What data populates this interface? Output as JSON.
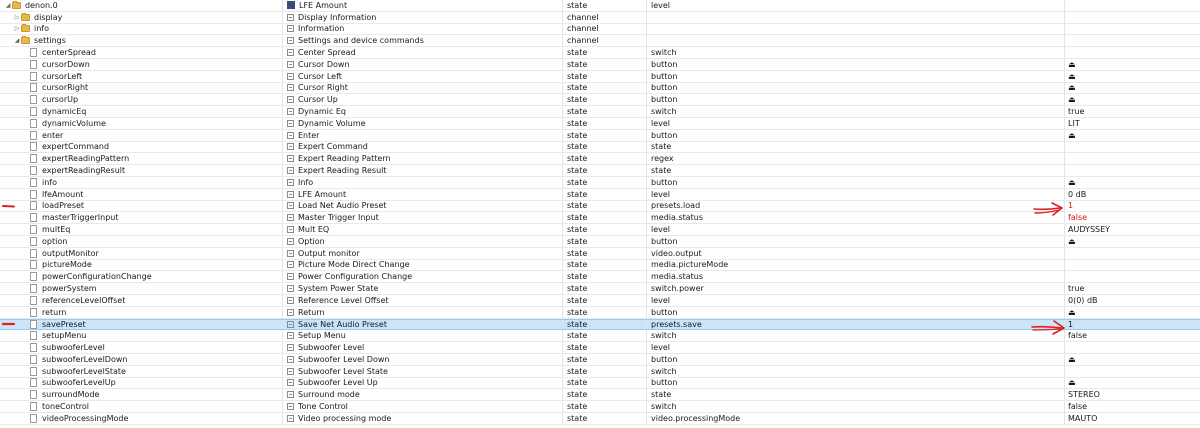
{
  "rows": [
    {
      "indent": 0,
      "expander": "◢",
      "icon": "folder",
      "id": "denon.0",
      "name": "LFE Amount",
      "name_icon": "device",
      "type": "state",
      "role": "level",
      "value": ""
    },
    {
      "indent": 1,
      "expander": "▷",
      "icon": "folder",
      "id": "display",
      "name": "Display Information",
      "name_icon": "doc",
      "type": "channel",
      "role": "",
      "value": ""
    },
    {
      "indent": 1,
      "expander": "▷",
      "icon": "folder",
      "id": "info",
      "name": "Information",
      "name_icon": "doc",
      "type": "channel",
      "role": "",
      "value": ""
    },
    {
      "indent": 1,
      "expander": "◢",
      "icon": "folder",
      "id": "settings",
      "name": "Settings and device commands",
      "name_icon": "doc",
      "type": "channel",
      "role": "",
      "value": ""
    },
    {
      "indent": 2,
      "icon": "file",
      "id": "centerSpread",
      "name": "Center Spread",
      "name_icon": "doc",
      "type": "state",
      "role": "switch",
      "value": ""
    },
    {
      "indent": 2,
      "icon": "file",
      "id": "cursorDown",
      "name": "Cursor Down",
      "name_icon": "doc",
      "type": "state",
      "role": "button",
      "value": "",
      "push": true
    },
    {
      "indent": 2,
      "icon": "file",
      "id": "cursorLeft",
      "name": "Cursor Left",
      "name_icon": "doc",
      "type": "state",
      "role": "button",
      "value": "",
      "push": true
    },
    {
      "indent": 2,
      "icon": "file",
      "id": "cursorRight",
      "name": "Cursor Right",
      "name_icon": "doc",
      "type": "state",
      "role": "button",
      "value": "",
      "push": true
    },
    {
      "indent": 2,
      "icon": "file",
      "id": "cursorUp",
      "name": "Cursor Up",
      "name_icon": "doc",
      "type": "state",
      "role": "button",
      "value": "",
      "push": true
    },
    {
      "indent": 2,
      "icon": "file",
      "id": "dynamicEq",
      "name": "Dynamic Eq",
      "name_icon": "doc",
      "type": "state",
      "role": "switch",
      "value": "true"
    },
    {
      "indent": 2,
      "icon": "file",
      "id": "dynamicVolume",
      "name": "Dynamic Volume",
      "name_icon": "doc",
      "type": "state",
      "role": "level",
      "value": "LIT"
    },
    {
      "indent": 2,
      "icon": "file",
      "id": "enter",
      "name": "Enter",
      "name_icon": "doc",
      "type": "state",
      "role": "button",
      "value": "",
      "push": true
    },
    {
      "indent": 2,
      "icon": "file",
      "id": "expertCommand",
      "name": "Expert Command",
      "name_icon": "doc",
      "type": "state",
      "role": "state",
      "value": ""
    },
    {
      "indent": 2,
      "icon": "file",
      "id": "expertReadingPattern",
      "name": "Expert Reading Pattern",
      "name_icon": "doc",
      "type": "state",
      "role": "regex",
      "value": ""
    },
    {
      "indent": 2,
      "icon": "file",
      "id": "expertReadingResult",
      "name": "Expert Reading Result",
      "name_icon": "doc",
      "type": "state",
      "role": "state",
      "value": ""
    },
    {
      "indent": 2,
      "icon": "file",
      "id": "info",
      "name": "Info",
      "name_icon": "doc",
      "type": "state",
      "role": "button",
      "value": "",
      "push": true
    },
    {
      "indent": 2,
      "icon": "file",
      "id": "lfeAmount",
      "name": "LFE Amount",
      "name_icon": "doc",
      "type": "state",
      "role": "level",
      "value": "0 dB"
    },
    {
      "indent": 2,
      "icon": "file",
      "id": "loadPreset",
      "name": "Load Net Audio Preset",
      "name_icon": "doc",
      "type": "state",
      "role": "presets.load",
      "value": "1",
      "red": true
    },
    {
      "indent": 2,
      "icon": "file",
      "id": "masterTriggerInput",
      "name": "Master Trigger Input",
      "name_icon": "doc",
      "type": "state",
      "role": "media.status",
      "value": "false",
      "red": true
    },
    {
      "indent": 2,
      "icon": "file",
      "id": "multEq",
      "name": "Mult EQ",
      "name_icon": "doc",
      "type": "state",
      "role": "level",
      "value": "AUDYSSEY"
    },
    {
      "indent": 2,
      "icon": "file",
      "id": "option",
      "name": "Option",
      "name_icon": "doc",
      "type": "state",
      "role": "button",
      "value": "",
      "push": true
    },
    {
      "indent": 2,
      "icon": "file",
      "id": "outputMonitor",
      "name": "Output monitor",
      "name_icon": "doc",
      "type": "state",
      "role": "video.output",
      "value": ""
    },
    {
      "indent": 2,
      "icon": "file",
      "id": "pictureMode",
      "name": "Picture Mode Direct Change",
      "name_icon": "doc",
      "type": "state",
      "role": "media.pictureMode",
      "value": ""
    },
    {
      "indent": 2,
      "icon": "file",
      "id": "powerConfigurationChange",
      "name": "Power Configuration Change",
      "name_icon": "doc",
      "type": "state",
      "role": "media.status",
      "value": ""
    },
    {
      "indent": 2,
      "icon": "file",
      "id": "powerSystem",
      "name": "System Power State",
      "name_icon": "doc",
      "type": "state",
      "role": "switch.power",
      "value": "true"
    },
    {
      "indent": 2,
      "icon": "file",
      "id": "referenceLevelOffset",
      "name": "Reference Level Offset",
      "name_icon": "doc",
      "type": "state",
      "role": "level",
      "value": "0(0) dB"
    },
    {
      "indent": 2,
      "icon": "file",
      "id": "return",
      "name": "Return",
      "name_icon": "doc",
      "type": "state",
      "role": "button",
      "value": "",
      "push": true
    },
    {
      "indent": 2,
      "icon": "file",
      "id": "savePreset",
      "name": "Save Net Audio Preset",
      "name_icon": "doc",
      "type": "state",
      "role": "presets.save",
      "value": "1",
      "selected": true
    },
    {
      "indent": 2,
      "icon": "file",
      "id": "setupMenu",
      "name": "Setup Menu",
      "name_icon": "doc",
      "type": "state",
      "role": "switch",
      "value": "false"
    },
    {
      "indent": 2,
      "icon": "file",
      "id": "subwooferLevel",
      "name": "Subwoofer Level",
      "name_icon": "doc",
      "type": "state",
      "role": "level",
      "value": ""
    },
    {
      "indent": 2,
      "icon": "file",
      "id": "subwooferLevelDown",
      "name": "Subwoofer Level Down",
      "name_icon": "doc",
      "type": "state",
      "role": "button",
      "value": "",
      "push": true
    },
    {
      "indent": 2,
      "icon": "file",
      "id": "subwooferLevelState",
      "name": "Subwoofer Level State",
      "name_icon": "doc",
      "type": "state",
      "role": "switch",
      "value": ""
    },
    {
      "indent": 2,
      "icon": "file",
      "id": "subwooferLevelUp",
      "name": "Subwoofer Level Up",
      "name_icon": "doc",
      "type": "state",
      "role": "button",
      "value": "",
      "push": true
    },
    {
      "indent": 2,
      "icon": "file",
      "id": "surroundMode",
      "name": "Surround mode",
      "name_icon": "doc",
      "type": "state",
      "role": "state",
      "value": "STEREO"
    },
    {
      "indent": 2,
      "icon": "file",
      "id": "toneControl",
      "name": "Tone Control",
      "name_icon": "doc",
      "type": "state",
      "role": "switch",
      "value": "false"
    },
    {
      "indent": 2,
      "icon": "file",
      "id": "videoProcessingMode",
      "name": "Video processing mode",
      "name_icon": "doc",
      "type": "state",
      "role": "video.processingMode",
      "value": "MAUTO"
    }
  ],
  "colors": {
    "annotation_red": "#e02020",
    "selection": "#cce4f7",
    "folder": "#e8b84a"
  }
}
